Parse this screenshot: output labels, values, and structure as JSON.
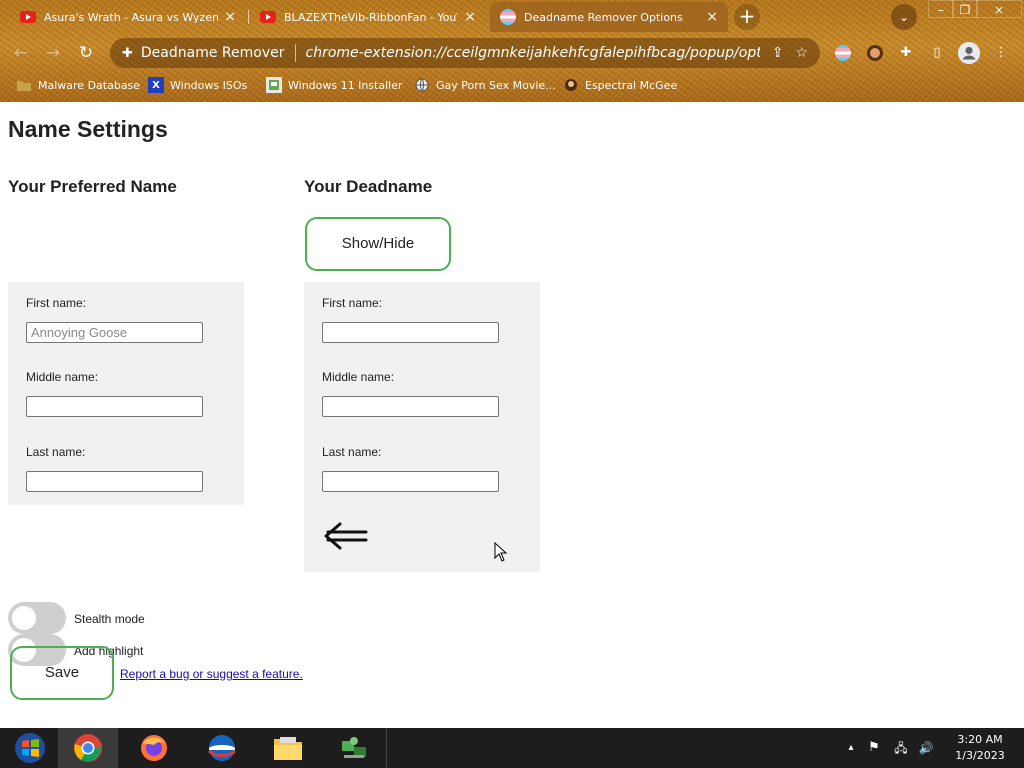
{
  "browser": {
    "tabs": [
      {
        "title": "Asura's Wrath - Asura vs Wyzen",
        "icon": "youtube-icon"
      },
      {
        "title": "BLAZEXTheVib-RibbonFan - YouT",
        "icon": "youtube-icon"
      },
      {
        "title": "Deadname Remover Options",
        "icon": "trans-flag-icon",
        "active": true
      }
    ],
    "close_glyph": "×",
    "new_tab_glyph": "+",
    "tab_search_glyph": "⌄",
    "window_controls": {
      "minimize": "–",
      "maximize": "❐",
      "close": "×"
    },
    "nav": {
      "back": "←",
      "forward": "→",
      "reload": "↻"
    },
    "omnibox": {
      "site": "Deadname Remover",
      "url": "chrome-extension://cceilgmnkeijahkehfcgfalepihfbcag/popup/option...",
      "share_glyph": "⇪",
      "star_glyph": "☆"
    },
    "toolbar_glyphs": {
      "extensions": "✚",
      "sidepanel": "▯",
      "menu": "⋮"
    },
    "bookmarks": [
      {
        "label": "Malware Database",
        "icon": "folder-icon"
      },
      {
        "label": "Windows ISOs",
        "icon": "x-icon"
      },
      {
        "label": "Windows 11 Installer",
        "icon": "page-icon"
      },
      {
        "label": "Gay Porn Sex Movie...",
        "icon": "globe-icon"
      },
      {
        "label": "Espectral McGee",
        "icon": "person-icon"
      }
    ]
  },
  "page": {
    "title": "Name Settings",
    "preferred": {
      "heading": "Your Preferred Name",
      "first_label": "First name:",
      "first_placeholder": "Annoying Goose",
      "middle_label": "Middle name:",
      "last_label": "Last name:"
    },
    "deadname": {
      "heading": "Your Deadname",
      "show_hide_label": "Show/Hide",
      "first_label": "First name:",
      "middle_label": "Middle name:",
      "last_label": "Last name:"
    },
    "toggles": [
      {
        "label": "Stealth mode",
        "on": false
      },
      {
        "label": "Add highlight",
        "on": false
      }
    ],
    "save_label": "Save",
    "report_link": "Report a bug or suggest a feature."
  },
  "taskbar": {
    "apps": [
      "start-icon",
      "chrome-icon",
      "firefox-icon",
      "opera-icon",
      "file-explorer-icon",
      "network-app-icon"
    ],
    "tray": {
      "chevron": "▴",
      "flag": "⚑",
      "network": "🖧",
      "volume": "🔊"
    },
    "time": "3:20 AM",
    "date": "1/3/2023"
  },
  "colors": {
    "accent_green": "#4caf50",
    "panel_gray": "#f1f1f1",
    "link_blue": "#1a0dab",
    "taskbar": "#1d1d1d"
  }
}
